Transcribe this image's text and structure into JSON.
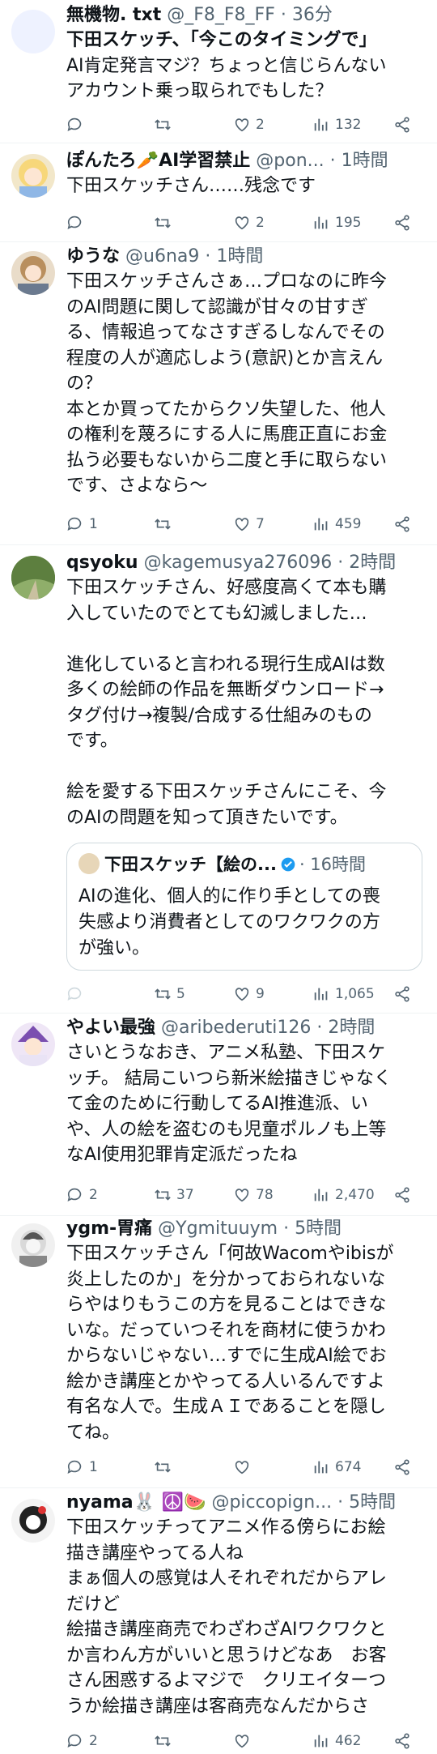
{
  "colors": {
    "text": "#0f1419",
    "muted": "#536471",
    "divider": "#eff3f4",
    "verified": "#1d9bf0"
  },
  "tweets": [
    {
      "name": "無機物. txt",
      "handle": "@_F8_F8_FF",
      "time": "36分",
      "lines": [
        "下田スケッチ、「今このタイミングで」",
        "AI肯定発言マジ？ちょっと信じらんない",
        "アカウント乗っ取られでもした？"
      ],
      "bold_prefix": "下田スケッチ",
      "likes": "2",
      "views": "132",
      "reply": "",
      "retweet": ""
    },
    {
      "name": "ぽんたろ🥕AI学習禁止",
      "handle": "@pon...",
      "time": "1時間",
      "lines": [
        "下田スケッチさん……残念です"
      ],
      "likes": "2",
      "views": "195"
    },
    {
      "name": "ゆうな",
      "handle": "@u6na9",
      "time": "1時間",
      "lines": [
        "下田スケッチさんさぁ…プロなのに昨今",
        "のAI問題に関して認識が甘々の甘すぎ",
        "る、情報追ってなさすぎるしなんでその",
        "程度の人が適応しよう(意訳)とか言えん",
        "の？",
        "本とか買ってたからクソ失望した、他人",
        "の権利を蔑ろにする人に馬鹿正直にお金",
        "払う必要もないから二度と手に取らない",
        "です、さよなら〜"
      ],
      "reply": "1",
      "likes": "7",
      "views": "459"
    },
    {
      "name": "qsyoku",
      "handle": "@kagemusya276096",
      "time": "2時間",
      "lines": [
        "下田スケッチさん、好感度高くて本も購",
        "入していたのでとても幻滅しました…",
        "",
        "進化していると言われる現行生成AIは数",
        "多くの絵師の作品を無断ダウンロード→",
        "タグ付け→複製/合成する仕組みのもの",
        "です。",
        "",
        "絵を愛する下田スケッチさんにこそ、今",
        "のAIの問題を知って頂きたいです。"
      ],
      "quote": {
        "name": "下田スケッチ【絵の...",
        "time": "16時間",
        "lines": [
          "AIの進化、個人的に作り手としての喪",
          "失感より消費者としてのワクワクの方",
          "が強い。"
        ]
      },
      "retweet": "5",
      "likes": "9",
      "views": "1,065"
    },
    {
      "name": "やよい最強",
      "handle": "@aribederuti126",
      "time": "2時間",
      "lines": [
        "さいとうなおき、アニメ私塾、下田スケ",
        "ッチ。 結局こいつら新米絵描きじゃなく",
        "て金のために行動してるAI推進派、い",
        "や、人の絵を盗むのも児童ポルノも上等",
        "なAI使用犯罪肯定派だったね"
      ],
      "reply": "2",
      "retweet": "37",
      "likes": "78",
      "views": "2,470"
    },
    {
      "name": "ygm-胃痛",
      "handle": "@Ygmituuym",
      "time": "5時間",
      "lines": [
        "下田スケッチさん「何故Wacomやibisが",
        "炎上したのか」を分かっておられないな",
        "らやはりもうこの方を見ることはできな",
        "いな。だっていつそれを商材に使うかわ",
        "からないじゃない…すでに生成AI絵でお",
        "絵かき講座とかやってる人いるんですよ",
        "有名な人で。生成ＡＩであることを隠し",
        "てね。"
      ],
      "reply": "1",
      "views": "674"
    },
    {
      "name": "nyama🐰 ☮️🍉",
      "handle": "@piccopign...",
      "time": "5時間",
      "lines": [
        "下田スケッチってアニメ作る傍らにお絵",
        "描き講座やってる人ね",
        "まぁ個人の感覚は人それぞれだからアレ",
        "だけど",
        "絵描き講座商売でわざわざAIワクワクと",
        "か言わん方がいいと思うけどなあ　お客",
        "さん困惑するよマジで　クリエイターつ",
        "うか絵描き講座は客商売なんだからさ"
      ],
      "reply": "2",
      "views": "462"
    }
  ]
}
